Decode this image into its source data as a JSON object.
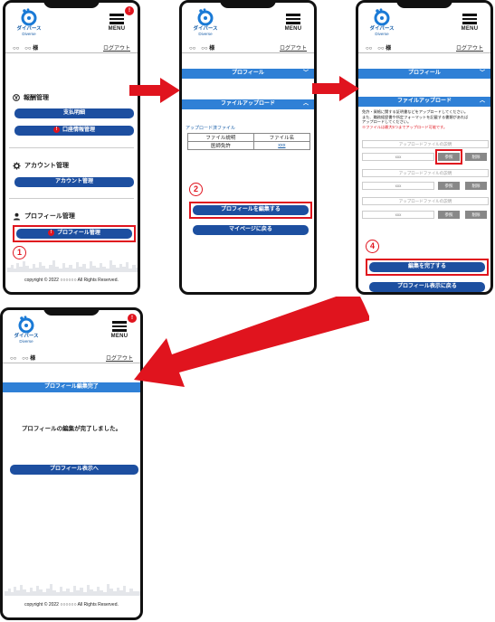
{
  "brand": {
    "name": "ダイバース",
    "sub": "Diverse"
  },
  "header": {
    "menu_label": "MENU",
    "notification_badge": "!"
  },
  "user": {
    "name": "○○　○○ 様",
    "logout": "ログアウト"
  },
  "screen1": {
    "section_payment": "報酬管理",
    "btn_payment_history": "支払明細",
    "btn_bank_info": "口座情報管理",
    "section_account": "アカウント管理",
    "btn_account": "アカウント管理",
    "section_profile": "プロフィール管理",
    "btn_profile": "プロフィール管理",
    "step": "1",
    "copyright": "copyright © 2022 ○○○○○○ All Rights Reserved."
  },
  "screen2": {
    "profile_bar": "プロフィール",
    "upload_bar": "ファイルアップロード",
    "uploaded_files_label": "アップロード済ファイル",
    "table_headers": [
      "ファイル説明",
      "ファイル名"
    ],
    "table_rows": [
      [
        "医師免許",
        "xxx"
      ]
    ],
    "btn_edit_profile": "プロフィールを編集する",
    "btn_back_mypage": "マイページに戻る",
    "step": "2"
  },
  "screen3": {
    "profile_bar": "プロフィール",
    "upload_bar": "ファイルアップロード",
    "notice_lines": [
      "免許・資格に関する証明書などをアップロードしてください。",
      "また、職務経歴書や所定フォーマットを記載する書類があれば",
      "アップロードしてください。"
    ],
    "notice_red": "※ファイルは最大5つまでアップロード可能です。",
    "file_desc_placeholder": "アップロードファイルの説明",
    "file_name_value": "xxx",
    "btn_browse": "参照",
    "btn_delete": "削除",
    "btn_complete": "編集を完了する",
    "btn_back_profile": "プロフィール表示に戻る",
    "step": "4"
  },
  "screen4": {
    "complete_bar": "プロフィール編集完了",
    "message": "プロフィールの編集が完了しました。",
    "btn_show_profile": "プロフィール表示へ",
    "copyright": "copyright © 2022 ○○○○○○ All Rights Reserved."
  }
}
